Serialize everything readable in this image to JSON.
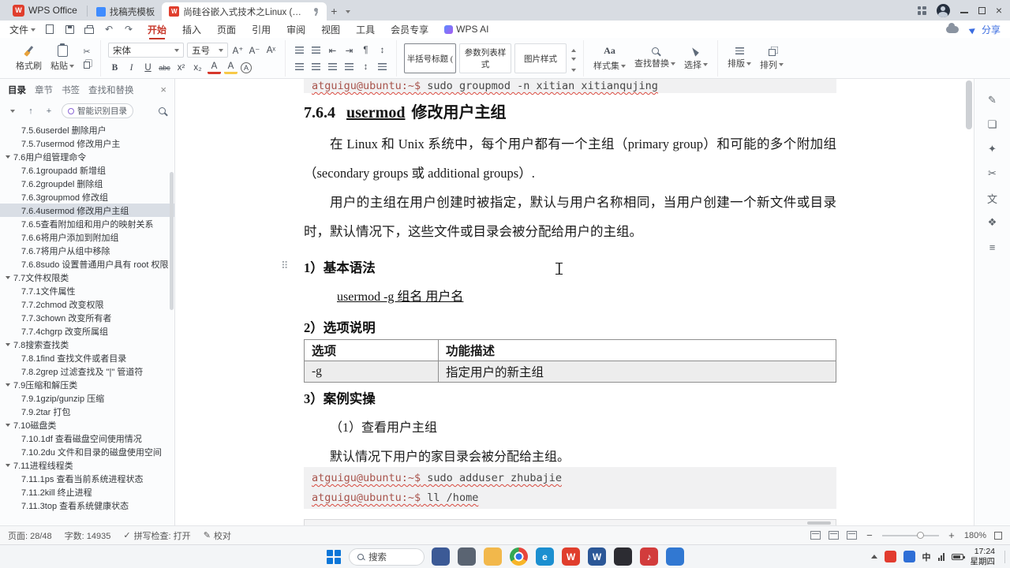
{
  "colors": {
    "accent": "#c7382b",
    "share_blue": "#3a6ce0",
    "code_prompt": "#a8544c",
    "selection_bg": "#d9dee5"
  },
  "titlebar": {
    "app": "WPS Office",
    "tab1": "找稿壳模板",
    "tab2": "尚硅谷嵌入式技术之Linux (位..."
  },
  "menubar": {
    "file": "文件",
    "items": [
      "开始",
      "插入",
      "页面",
      "引用",
      "审阅",
      "视图",
      "工具",
      "会员专享",
      "WPS AI"
    ],
    "active": "开始",
    "share": "分享"
  },
  "ribbon": {
    "format_painter": "格式刷",
    "paste": "粘贴",
    "font_name": "宋体",
    "font_size": "五号",
    "style_cards": [
      "半括号标题 (",
      "参数列表样式",
      "图片样式"
    ],
    "style_set": "样式集",
    "find_replace": "查找替换",
    "select": "选择",
    "typeset": "排版",
    "arrange": "排列"
  },
  "sidebar": {
    "tabs": [
      "目录",
      "章节",
      "书签",
      "查找和替换"
    ],
    "active_tab": "目录",
    "smart_btn": "智能识别目录",
    "items": [
      {
        "label": "7.5.6userdel 删除用户",
        "level": 1
      },
      {
        "label": "7.5.7usermod 修改用户主",
        "level": 1
      },
      {
        "label": "7.6用户组管理命令",
        "level": 0
      },
      {
        "label": "7.6.1groupadd 新增组",
        "level": 1
      },
      {
        "label": "7.6.2groupdel 删除组",
        "level": 1
      },
      {
        "label": "7.6.3groupmod 修改组",
        "level": 1
      },
      {
        "label": "7.6.4usermod 修改用户主组",
        "level": 1,
        "selected": true
      },
      {
        "label": "7.6.5查看附加组和用户的映射关系",
        "level": 1
      },
      {
        "label": "7.6.6将用户添加到附加组",
        "level": 1
      },
      {
        "label": "7.6.7将用户从组中移除",
        "level": 1
      },
      {
        "label": "7.6.8sudo 设置普通用户具有 root 权限",
        "level": 1
      },
      {
        "label": "7.7文件权限类",
        "level": 0
      },
      {
        "label": "7.7.1文件属性",
        "level": 1
      },
      {
        "label": "7.7.2chmod 改变权限",
        "level": 1
      },
      {
        "label": "7.7.3chown 改变所有者",
        "level": 1
      },
      {
        "label": "7.7.4chgrp 改变所属组",
        "level": 1
      },
      {
        "label": "7.8搜索查找类",
        "level": 0
      },
      {
        "label": "7.8.1find 查找文件或者目录",
        "level": 1
      },
      {
        "label": "7.8.2grep 过滤查找及 \"|\" 管道符",
        "level": 1
      },
      {
        "label": "7.9压缩和解压类",
        "level": 0
      },
      {
        "label": "7.9.1gzip/gunzip 压缩",
        "level": 1
      },
      {
        "label": "7.9.2tar 打包",
        "level": 1
      },
      {
        "label": "7.10磁盘类",
        "level": 0
      },
      {
        "label": "7.10.1df 查看磁盘空间使用情况",
        "level": 1
      },
      {
        "label": "7.10.2du 文件和目录的磁盘使用空间",
        "level": 1
      },
      {
        "label": "7.11进程线程类",
        "level": 0
      },
      {
        "label": "7.11.1ps 查看当前系统进程状态",
        "level": 1
      },
      {
        "label": "7.11.2kill 终止进程",
        "level": 1
      },
      {
        "label": "7.11.3top 查看系统健康状态",
        "level": 1
      }
    ]
  },
  "document": {
    "code_top": "atguigu@ubuntu:~$ sudo groupmod -n xitian xitianqujing",
    "heading": {
      "num": "7.6.4",
      "keyword": "usermod",
      "rest": "修改用户主组"
    },
    "para1": "在 Linux 和 Unix 系统中，每个用户都有一个主组（primary group）和可能的多个附加组（secondary groups 或 additional groups）.",
    "para2": "用户的主组在用户创建时被指定，默认与用户名称相同，当用户创建一个新文件或目录时，默认情况下，这些文件或目录会被分配给用户的主组。",
    "section1": "1）基本语法",
    "syntax": "usermod -g  组名  用户名",
    "section2": "2）选项说明",
    "table": {
      "headers": [
        "选项",
        "功能描述"
      ],
      "rows": [
        [
          "-g",
          "指定用户的新主组"
        ]
      ]
    },
    "section3": "3）案例实操",
    "case_title": "（1）查看用户主组",
    "case_desc": "默认情况下用户的家目录会被分配给主组。",
    "code_block": [
      "atguigu@ubuntu:~$ sudo adduser zhubajie",
      "atguigu@ubuntu:~$ ll /home"
    ]
  },
  "right_toolbar": [
    {
      "name": "edit-mode-icon",
      "glyph": "✎"
    },
    {
      "name": "comment-icon",
      "glyph": "❏"
    },
    {
      "name": "highlighter-icon",
      "glyph": "✦"
    },
    {
      "name": "snapshot-icon",
      "glyph": "✂"
    },
    {
      "name": "translate-icon",
      "glyph": "文"
    },
    {
      "name": "bookmark-icon",
      "glyph": "❖"
    },
    {
      "name": "more-tools-icon",
      "glyph": "≡"
    }
  ],
  "statusbar": {
    "page": "页面: 28/48",
    "words": "字数: 14935",
    "spell": "拼写检查: 打开",
    "proof": "校对",
    "zoom": "180%"
  },
  "taskbar": {
    "search": "搜索",
    "apps": [
      {
        "name": "task-view-icon",
        "color": "#3c5a96",
        "glyph": ""
      },
      {
        "name": "settings-icon",
        "color": "#5a6472",
        "glyph": ""
      },
      {
        "name": "file-explorer-icon",
        "color": "#f2b84b",
        "glyph": ""
      },
      {
        "name": "chrome-icon",
        "chrome": true,
        "glyph": ""
      },
      {
        "name": "edge-icon",
        "color": "#1b8fd0",
        "glyph": "e"
      },
      {
        "name": "wps-icon",
        "color": "#e03e2d",
        "glyph": "W"
      },
      {
        "name": "word-icon",
        "color": "#2b5797",
        "glyph": "W"
      },
      {
        "name": "vscode-icon",
        "color": "#2c2c32",
        "glyph": ""
      },
      {
        "name": "music-icon",
        "color": "#d23c3c",
        "glyph": "♪"
      },
      {
        "name": "browser-icon",
        "color": "#3178d2",
        "glyph": ""
      }
    ],
    "ime": "中",
    "time": "17:24",
    "date": "星期四"
  },
  "icons": {
    "drag_handle": "⠿",
    "scissors": "✂",
    "undo": "↶",
    "redo": "↷",
    "bold": "B",
    "italic": "I",
    "underline": "U",
    "strikethrough": "abc",
    "superscript": "x²",
    "subscript": "x₂",
    "font_color": "A",
    "highlight": "A",
    "char_circle": "A",
    "pilcrow": "¶",
    "indent_left": "⇤",
    "indent_right": "⇥",
    "line_spacing": "↕",
    "check": "✓",
    "pen": "✎"
  }
}
